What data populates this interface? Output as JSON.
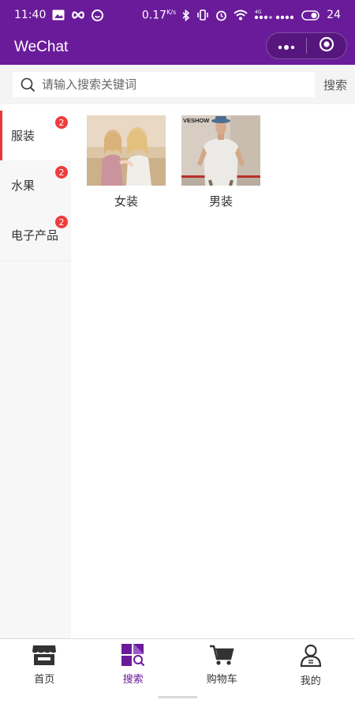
{
  "status_bar": {
    "time": "11:40",
    "speed": "0.17",
    "speed_unit": "K/s",
    "network": "4G",
    "battery": "24"
  },
  "title_bar": {
    "title": "WeChat",
    "icons": [
      "more-dots-icon",
      "record-circle-icon"
    ]
  },
  "search": {
    "placeholder": "请输入搜索关键词",
    "button_label": "搜索"
  },
  "sidebar": {
    "items": [
      {
        "label": "服装",
        "badge": "2",
        "active": true
      },
      {
        "label": "水果",
        "badge": "2",
        "active": false
      },
      {
        "label": "电子产品",
        "badge": "2",
        "active": false
      }
    ]
  },
  "products": [
    {
      "label": "女装",
      "image_icon": "women-clothing-photo"
    },
    {
      "label": "男装",
      "image_icon": "men-clothing-photo",
      "image_text": "VESHOW"
    }
  ],
  "tab_bar": {
    "tabs": [
      {
        "label": "首页",
        "icon": "store-icon",
        "active": false
      },
      {
        "label": "搜索",
        "icon": "search-grid-icon",
        "active": true
      },
      {
        "label": "购物车",
        "icon": "cart-icon",
        "active": false
      },
      {
        "label": "我的",
        "icon": "user-icon",
        "active": false
      }
    ]
  },
  "colors": {
    "brand": "#6a1b9a",
    "badge": "#f03c3c",
    "active_indicator": "#e53935"
  }
}
